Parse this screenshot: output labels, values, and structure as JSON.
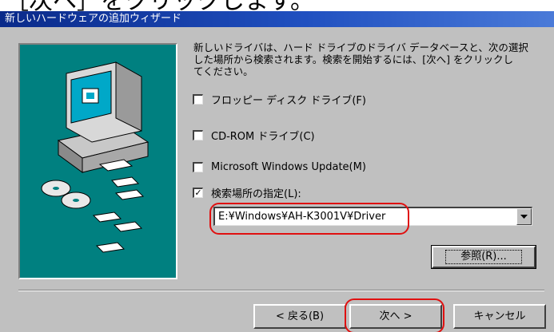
{
  "caption": "［次へ］をクリックします。",
  "window": {
    "title": "新しいハードウェアの追加ウィザード"
  },
  "description": [
    "新しいドライバは、ハード ドライブのドライバ データベースと、次の選択",
    "した場所から検索されます。検索を開始するには、[次へ] をクリックし",
    "てください。"
  ],
  "options": [
    {
      "label": "フロッピー ディスク ドライブ(F)",
      "checked": false
    },
    {
      "label": "CD-ROM ドライブ(C)",
      "checked": false
    },
    {
      "label": "Microsoft Windows Update(M)",
      "checked": false
    },
    {
      "label": "検索場所の指定(L):",
      "checked": true
    }
  ],
  "check_mark": "✓",
  "path": {
    "value": "E:¥Windows¥AH-K3001V¥Driver"
  },
  "buttons": {
    "browse": "参照(R)...",
    "back": "< 戻る(B)",
    "next": "次へ >",
    "cancel": "キャンセル"
  },
  "icons": {
    "dropdown": "chevron-down-icon",
    "illustration": "computer-with-discs-illustration"
  },
  "colors": {
    "panel": "#008080",
    "dialog": "#c0c0c0",
    "title_start": "#0a2a8a",
    "highlight": "#e01010"
  }
}
